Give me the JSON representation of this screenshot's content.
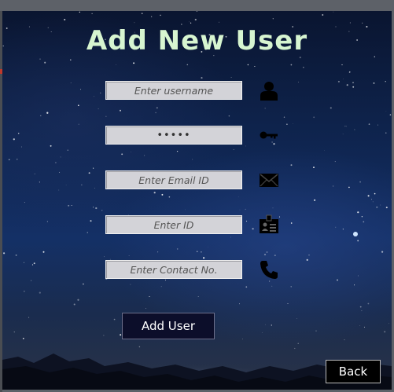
{
  "form": {
    "title": "Add New User",
    "fields": [
      {
        "name": "username",
        "placeholder": "Enter username",
        "value": "",
        "icon": "user-icon"
      },
      {
        "name": "password",
        "placeholder": "",
        "value": "•••••",
        "icon": "key-icon"
      },
      {
        "name": "email",
        "placeholder": "Enter Email ID",
        "value": "",
        "icon": "envelope-icon"
      },
      {
        "name": "id",
        "placeholder": "Enter ID",
        "value": "",
        "icon": "id-badge-icon"
      },
      {
        "name": "contact",
        "placeholder": "Enter Contact No.",
        "value": "",
        "icon": "phone-icon"
      }
    ],
    "add_label": "Add User",
    "back_label": "Back"
  },
  "colors": {
    "title": "#d7f5d0",
    "field_bg": "#d3d3d8",
    "button_bg": "#0c0e2a",
    "back_bg": "#000000"
  }
}
